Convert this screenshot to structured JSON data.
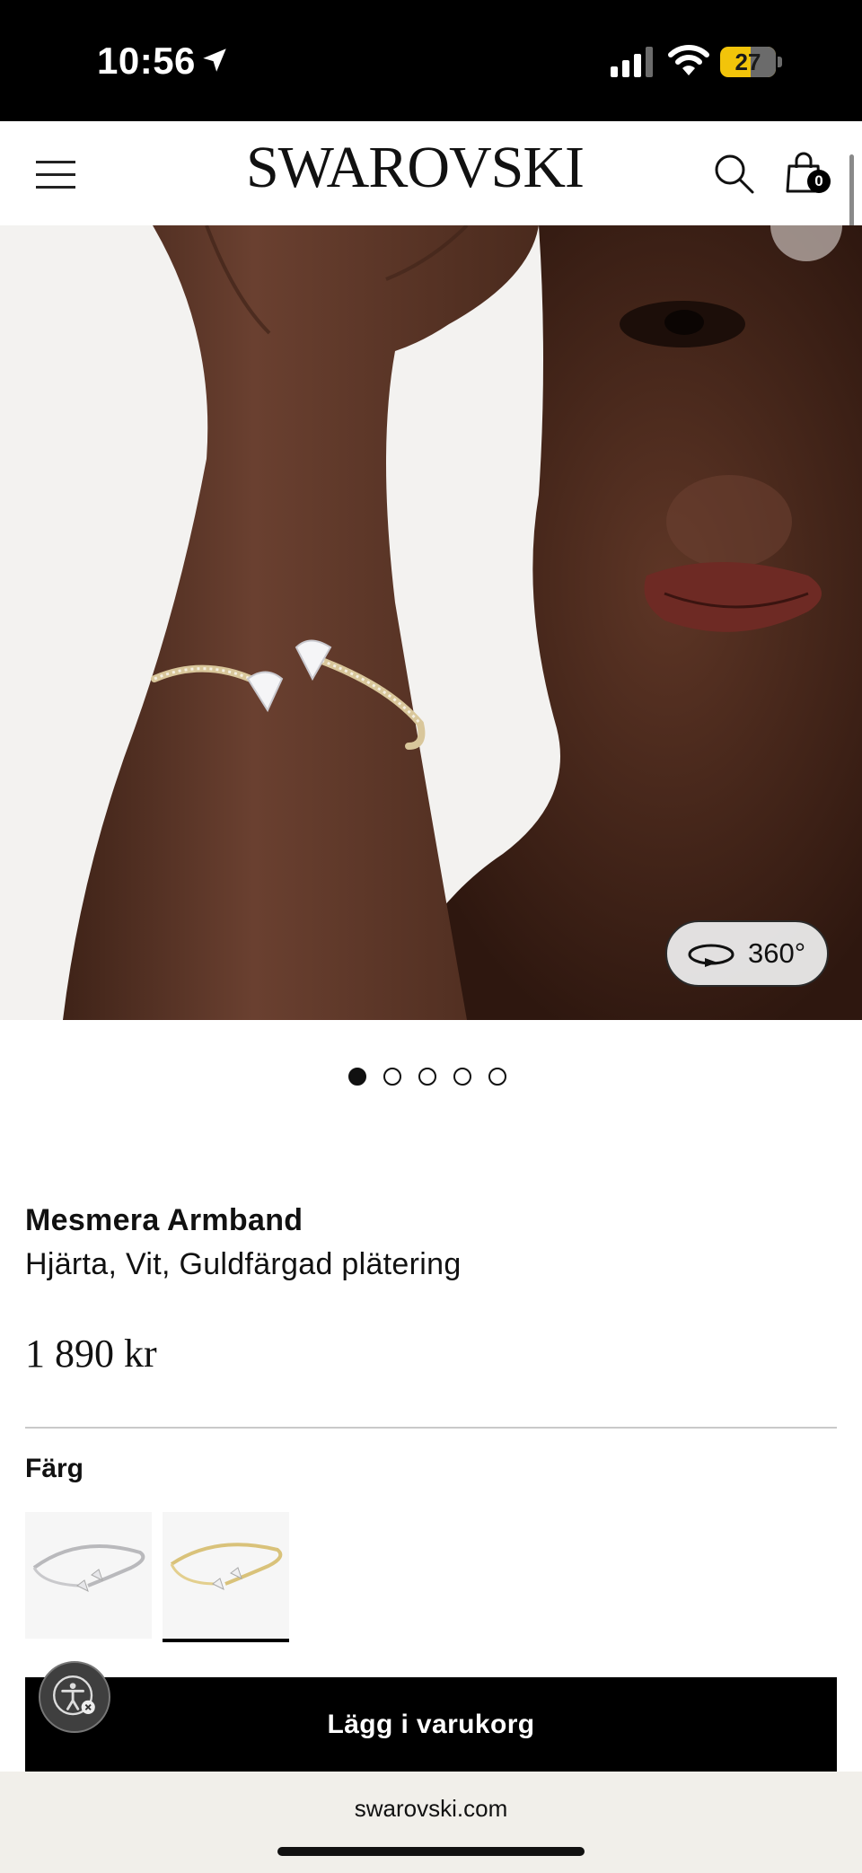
{
  "status_bar": {
    "time": "10:56",
    "battery": "27"
  },
  "header": {
    "logo": "SWAROVSKI",
    "cart_count": "0"
  },
  "gallery": {
    "view_360_label": "360°",
    "slide_count": 5,
    "active_slide": 1
  },
  "product": {
    "name": "Mesmera Armband",
    "description": "Hjärta, Vit, Guldfärgad plätering",
    "price": "1 890 kr"
  },
  "color_picker": {
    "label": "Färg",
    "selected_index": 1
  },
  "actions": {
    "add_to_cart": "Lägg i varukorg"
  },
  "browser": {
    "url": "swarovski.com"
  }
}
